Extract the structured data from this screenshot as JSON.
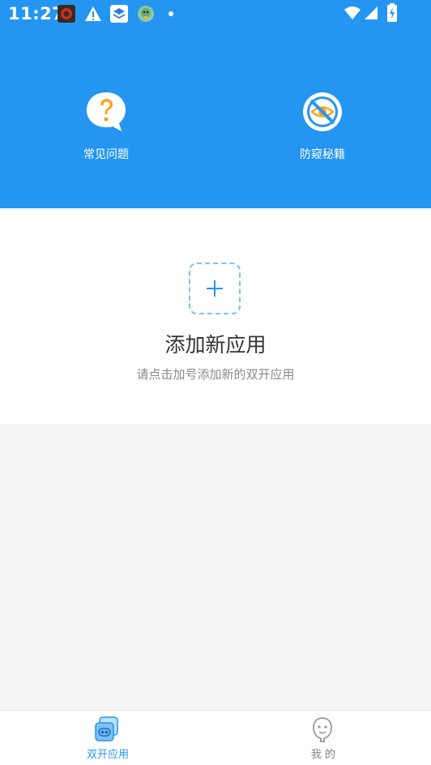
{
  "status_bar": {
    "time": "11:27",
    "icons": [
      "app-notification-icon",
      "warning-icon",
      "layers-app-icon",
      "bird-app-icon",
      "dot-icon",
      "wifi-icon",
      "signal-icon",
      "battery-charging-icon"
    ]
  },
  "header": {
    "features": [
      {
        "label": "常见问题",
        "icon": "question-bubble-icon"
      },
      {
        "label": "防窥秘籍",
        "icon": "hidden-eye-icon"
      }
    ]
  },
  "empty_state": {
    "title": "添加新应用",
    "subtitle": "请点击加号添加新的双开应用"
  },
  "bottom_nav": {
    "items": [
      {
        "label": "双开应用",
        "icon": "dual-apps-icon"
      },
      {
        "label": "我 的",
        "icon": "profile-face-icon"
      }
    ]
  },
  "colors": {
    "primary": "#2496f2",
    "orange": "#f5a623",
    "nav_active": "#2496f2",
    "nav_inactive": "#808080"
  }
}
